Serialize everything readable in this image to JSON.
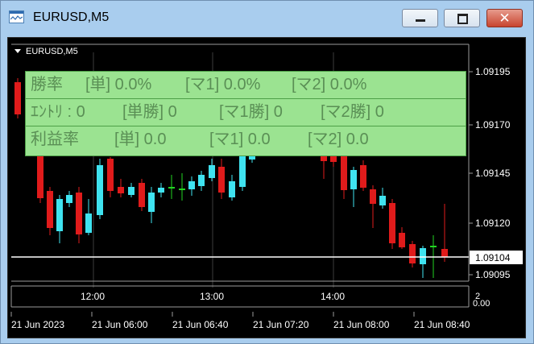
{
  "window": {
    "title": "EURUSD,M5",
    "close_glyph": "✕"
  },
  "chart": {
    "symbol_label": "EURUSD,M5",
    "current_price": "1.09104",
    "price_ticks": [
      "1.09195",
      "1.09170",
      "1.09145",
      "1.09120",
      "1.09095"
    ],
    "time_ticks": [
      "12:00",
      "13:00",
      "14:00"
    ],
    "bottom_dates": [
      "21 Jun 2023",
      "21 Jun 06:00",
      "21 Jun 06:40",
      "21 Jun 07:20",
      "21 Jun 08:00",
      "21 Jun 08:40"
    ],
    "subwindow_labels": [
      "2",
      "0.00"
    ],
    "colors": {
      "background": "#000000",
      "bull": "#3fe3f0",
      "bear": "#e01b1b",
      "doji": "#22d422",
      "grid": "#3b3b3b",
      "text": "#ffffff"
    }
  },
  "info_panel": {
    "row1": [
      "勝率",
      "[単] 0.0%",
      "[マ1] 0.0%",
      "[マ2] 0.0%"
    ],
    "row2": [
      "ｴﾝﾄﾘ : 0",
      "[単勝] 0",
      "[マ1勝] 0",
      "[マ2勝] 0"
    ],
    "row3": [
      "利益率",
      "[単] 0.0",
      "[マ1] 0.0",
      "[マ2] 0.0"
    ]
  }
}
